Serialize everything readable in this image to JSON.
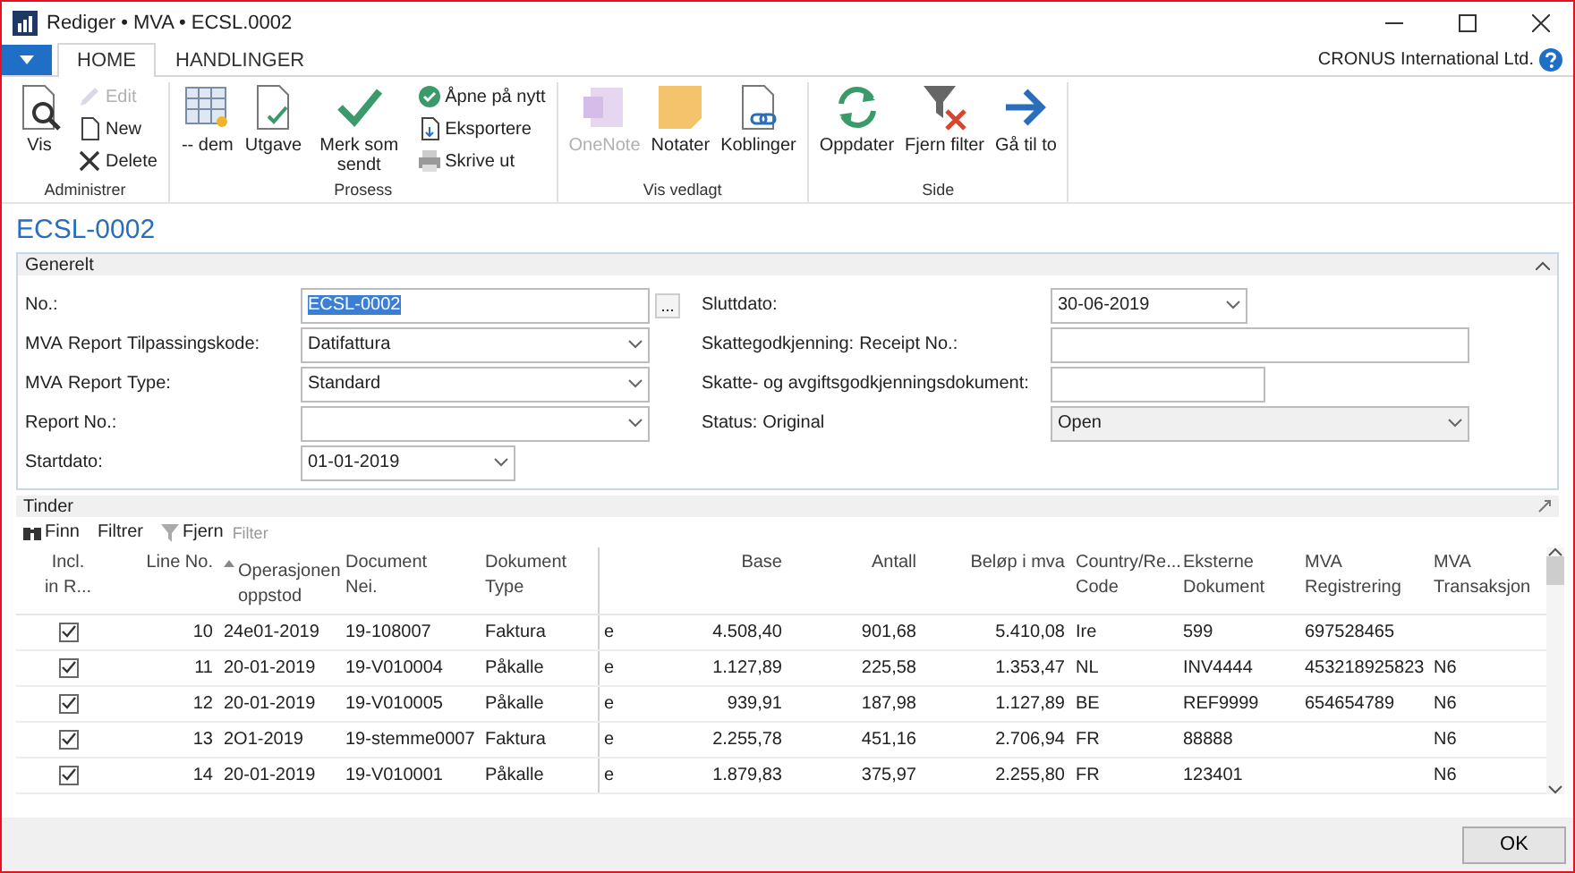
{
  "window": {
    "title": "Rediger • MVA • ECSL.0002"
  },
  "tabs": [
    {
      "label": "HOME",
      "selected": true
    },
    {
      "label": "HANDLINGER",
      "selected": false
    }
  ],
  "company": "CRONUS International Ltd.",
  "ribbon": [
    {
      "label": "Administrer",
      "items": [
        {
          "kind": "large",
          "label": "Vis",
          "disabled": false
        },
        {
          "kind": "stack",
          "items": [
            {
              "label": "Edit",
              "disabled": true
            },
            {
              "label": "New",
              "disabled": false
            },
            {
              "label": "Delete",
              "disabled": false
            }
          ]
        }
      ]
    },
    {
      "label": "Prosess",
      "items": [
        {
          "kind": "large",
          "label": "-- dem",
          "disabled": false
        },
        {
          "kind": "large",
          "label": "Utgave",
          "disabled": false
        },
        {
          "kind": "large",
          "label": "Merk som sendt",
          "disabled": false
        },
        {
          "kind": "stack",
          "items": [
            {
              "label": "Åpne på nytt",
              "disabled": false
            },
            {
              "label": "Eksportere",
              "disabled": false
            },
            {
              "label": "Skrive ut",
              "disabled": false
            }
          ]
        }
      ]
    },
    {
      "label": "Vis vedlagt",
      "items": [
        {
          "kind": "large",
          "label": "OneNote",
          "disabled": true
        },
        {
          "kind": "large",
          "label": "Notater",
          "disabled": false
        },
        {
          "kind": "large",
          "label": "Koblinger",
          "disabled": false
        }
      ]
    },
    {
      "label": "Side",
      "items": [
        {
          "kind": "large",
          "label": "Oppdater",
          "disabled": false
        },
        {
          "kind": "large",
          "label": "Fjern filter",
          "disabled": false
        },
        {
          "kind": "large",
          "label": "Gå til to",
          "disabled": false
        }
      ]
    }
  ],
  "page_title": "ECSL-0002",
  "general": {
    "title": "Generelt",
    "left_fields": [
      {
        "labels": [
          "No.:"
        ],
        "kind": "text",
        "value": "ECSL-0002",
        "assist": "...",
        "text_selected": true,
        "disabled": false
      },
      {
        "labels": [
          "MVA",
          "Report",
          "Tilpassingskode:"
        ],
        "kind": "select",
        "value": "Datifattura",
        "text_selected": false,
        "disabled": false
      },
      {
        "labels": [
          "MVA",
          "Report",
          "Type:"
        ],
        "kind": "select",
        "value": "Standard",
        "text_selected": false,
        "disabled": false
      },
      {
        "labels": [
          "Report No.:"
        ],
        "kind": "select",
        "disabled": false
      },
      {
        "labels": [
          "Startdato:"
        ],
        "kind": "date",
        "value": "01-01-2019",
        "text_selected": false,
        "disabled": false
      }
    ],
    "right_fields": [
      {
        "labels": [
          "Sluttdato:"
        ],
        "kind": "date",
        "value": "30-06-2019",
        "text_selected": false,
        "disabled": false
      },
      {
        "labels": [
          "Skattegodkjenning:",
          "Receipt No.:"
        ],
        "kind": "text",
        "disabled": false
      },
      {
        "labels": [
          "Skatte- og avgiftsgodkjenningsdokument:"
        ],
        "kind": "short-text",
        "disabled": false
      },
      {
        "labels": [
          "Status:",
          "Original"
        ],
        "kind": "select",
        "value": "Open",
        "text_selected": false,
        "disabled": true
      }
    ]
  },
  "lines": {
    "title": "Tinder",
    "toolbar": [
      {
        "label": "Finn"
      },
      {
        "label": "Filtrer"
      },
      {
        "label": "Fjern",
        "hint": "Filter"
      }
    ],
    "columns": [
      {
        "header": [
          "Incl.",
          "in R..."
        ],
        "kind": "check",
        "sorted": false
      },
      {
        "header": [
          "Line No."
        ],
        "kind": "number",
        "sorted": false
      },
      {
        "header": [
          "Operasjonen",
          "oppstod"
        ],
        "kind": "text",
        "sorted": true
      },
      {
        "header": [
          "Document",
          "Nei."
        ],
        "kind": "text",
        "sorted": false
      },
      {
        "header": [
          "Dokument",
          "Type"
        ],
        "kind": "text",
        "sorted": false
      },
      {
        "kind": "text",
        "sorted": false
      },
      {
        "header": [
          "Base"
        ],
        "kind": "number",
        "sorted": false
      },
      {
        "header": [
          "Antall"
        ],
        "kind": "number",
        "sorted": false
      },
      {
        "header": [
          "Beløp i mva"
        ],
        "kind": "number",
        "sorted": false
      },
      {
        "header": [
          "Country/Re...",
          "Code"
        ],
        "kind": "text",
        "sorted": false
      },
      {
        "header": [
          "Eksterne",
          "Dokument"
        ],
        "kind": "text",
        "sorted": false
      },
      {
        "header": [
          "MVA",
          "Registrering"
        ],
        "kind": "text",
        "sorted": false
      },
      {
        "header": [
          "MVA",
          "Transaksjon"
        ],
        "kind": "text",
        "sorted": false
      }
    ],
    "rows": [
      {
        "included": true,
        "cells": [
          null,
          "10",
          "24e01-2019",
          "19-108007",
          "Faktura",
          "e",
          "4.508,40",
          "901,68",
          "5.410,08",
          "Ire",
          "599",
          "697528465",
          null
        ]
      },
      {
        "included": true,
        "cells": [
          null,
          "11",
          "20-01-2019",
          "19-V010004",
          "Påkalle",
          "e",
          "1.127,89",
          "225,58",
          "1.353,47",
          "NL",
          "INV4444",
          "453218925823",
          "N6"
        ]
      },
      {
        "included": true,
        "cells": [
          null,
          "12",
          "20-01-2019",
          "19-V010005",
          "Påkalle",
          "e",
          "939,91",
          "187,98",
          "1.127,89",
          "BE",
          "REF9999",
          "654654789",
          "N6"
        ]
      },
      {
        "included": true,
        "cells": [
          null,
          "13",
          "2O1-2019",
          "19-stemme0007",
          "Faktura",
          "e",
          "2.255,78",
          "451,16",
          "2.706,94",
          "FR",
          "88888",
          null,
          "N6"
        ]
      },
      {
        "included": true,
        "cells": [
          null,
          "14",
          "20-01-2019",
          "19-V010001",
          "Påkalle",
          "e",
          "1.879,83",
          "375,97",
          "2.255,80",
          "FR",
          "123401",
          null,
          "N6"
        ]
      }
    ]
  },
  "footer_buttons": [
    "OK"
  ]
}
